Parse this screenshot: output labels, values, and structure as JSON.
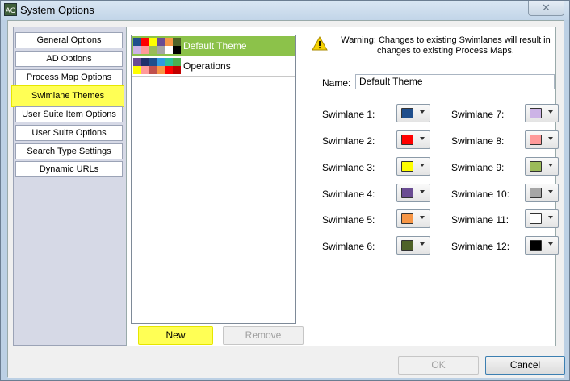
{
  "window": {
    "title": "System Options",
    "app_icon_text": "AC"
  },
  "nav": {
    "tabs": [
      {
        "label": "General Options"
      },
      {
        "label": "AD Options"
      },
      {
        "label": "Process Map Options"
      },
      {
        "label": "Swimlane Themes"
      },
      {
        "label": "User Suite Item Options"
      },
      {
        "label": "User Suite Options"
      },
      {
        "label": "Search Type Settings"
      },
      {
        "label": "Dynamic URLs"
      }
    ],
    "active": "Swimlane Themes"
  },
  "themes": [
    {
      "name": "Default Theme",
      "selected": true
    },
    {
      "name": "Operations",
      "selected": false
    }
  ],
  "theme_buttons": {
    "new": "New",
    "remove": "Remove"
  },
  "warning": "Warning: Changes to existing Swimlanes will result in changes to existing Process Maps.",
  "name_field": {
    "label": "Name:",
    "value": "Default Theme"
  },
  "swimlanes": [
    {
      "label": "Swimlane 1:",
      "color": "#1f4e8c"
    },
    {
      "label": "Swimlane 2:",
      "color": "#ff0000"
    },
    {
      "label": "Swimlane 3:",
      "color": "#ffff00"
    },
    {
      "label": "Swimlane 4:",
      "color": "#6a4c93"
    },
    {
      "label": "Swimlane 5:",
      "color": "#f79646"
    },
    {
      "label": "Swimlane 6:",
      "color": "#4f6228"
    },
    {
      "label": "Swimlane 7:",
      "color": "#ccb3e6"
    },
    {
      "label": "Swimlane 8:",
      "color": "#ff9a9a"
    },
    {
      "label": "Swimlane 9:",
      "color": "#9bbb59"
    },
    {
      "label": "Swimlane 10:",
      "color": "#a6a6a6"
    },
    {
      "label": "Swimlane 11:",
      "color": "#ffffff"
    },
    {
      "label": "Swimlane 12:",
      "color": "#000000"
    }
  ],
  "footer": {
    "ok": "OK",
    "cancel": "Cancel"
  },
  "colors": {
    "highlight": "#ffff55",
    "selected_theme": "#8cc24a"
  }
}
